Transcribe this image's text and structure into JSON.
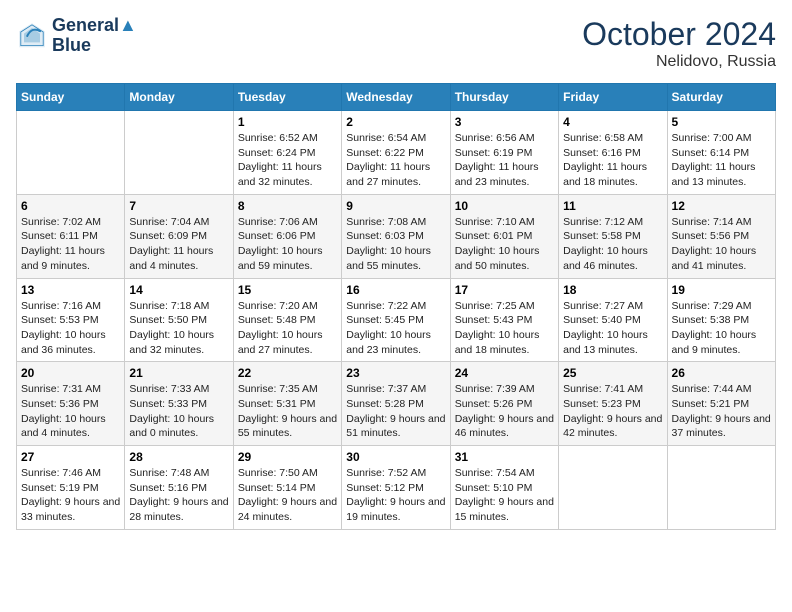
{
  "logo": {
    "line1": "General",
    "line2": "Blue"
  },
  "title": "October 2024",
  "location": "Nelidovo, Russia",
  "weekdays": [
    "Sunday",
    "Monday",
    "Tuesday",
    "Wednesday",
    "Thursday",
    "Friday",
    "Saturday"
  ],
  "weeks": [
    [
      null,
      null,
      {
        "day": 1,
        "sunrise": "6:52 AM",
        "sunset": "6:24 PM",
        "daylight": "11 hours and 32 minutes."
      },
      {
        "day": 2,
        "sunrise": "6:54 AM",
        "sunset": "6:22 PM",
        "daylight": "11 hours and 27 minutes."
      },
      {
        "day": 3,
        "sunrise": "6:56 AM",
        "sunset": "6:19 PM",
        "daylight": "11 hours and 23 minutes."
      },
      {
        "day": 4,
        "sunrise": "6:58 AM",
        "sunset": "6:16 PM",
        "daylight": "11 hours and 18 minutes."
      },
      {
        "day": 5,
        "sunrise": "7:00 AM",
        "sunset": "6:14 PM",
        "daylight": "11 hours and 13 minutes."
      }
    ],
    [
      {
        "day": 6,
        "sunrise": "7:02 AM",
        "sunset": "6:11 PM",
        "daylight": "11 hours and 9 minutes."
      },
      {
        "day": 7,
        "sunrise": "7:04 AM",
        "sunset": "6:09 PM",
        "daylight": "11 hours and 4 minutes."
      },
      {
        "day": 8,
        "sunrise": "7:06 AM",
        "sunset": "6:06 PM",
        "daylight": "10 hours and 59 minutes."
      },
      {
        "day": 9,
        "sunrise": "7:08 AM",
        "sunset": "6:03 PM",
        "daylight": "10 hours and 55 minutes."
      },
      {
        "day": 10,
        "sunrise": "7:10 AM",
        "sunset": "6:01 PM",
        "daylight": "10 hours and 50 minutes."
      },
      {
        "day": 11,
        "sunrise": "7:12 AM",
        "sunset": "5:58 PM",
        "daylight": "10 hours and 46 minutes."
      },
      {
        "day": 12,
        "sunrise": "7:14 AM",
        "sunset": "5:56 PM",
        "daylight": "10 hours and 41 minutes."
      }
    ],
    [
      {
        "day": 13,
        "sunrise": "7:16 AM",
        "sunset": "5:53 PM",
        "daylight": "10 hours and 36 minutes."
      },
      {
        "day": 14,
        "sunrise": "7:18 AM",
        "sunset": "5:50 PM",
        "daylight": "10 hours and 32 minutes."
      },
      {
        "day": 15,
        "sunrise": "7:20 AM",
        "sunset": "5:48 PM",
        "daylight": "10 hours and 27 minutes."
      },
      {
        "day": 16,
        "sunrise": "7:22 AM",
        "sunset": "5:45 PM",
        "daylight": "10 hours and 23 minutes."
      },
      {
        "day": 17,
        "sunrise": "7:25 AM",
        "sunset": "5:43 PM",
        "daylight": "10 hours and 18 minutes."
      },
      {
        "day": 18,
        "sunrise": "7:27 AM",
        "sunset": "5:40 PM",
        "daylight": "10 hours and 13 minutes."
      },
      {
        "day": 19,
        "sunrise": "7:29 AM",
        "sunset": "5:38 PM",
        "daylight": "10 hours and 9 minutes."
      }
    ],
    [
      {
        "day": 20,
        "sunrise": "7:31 AM",
        "sunset": "5:36 PM",
        "daylight": "10 hours and 4 minutes."
      },
      {
        "day": 21,
        "sunrise": "7:33 AM",
        "sunset": "5:33 PM",
        "daylight": "10 hours and 0 minutes."
      },
      {
        "day": 22,
        "sunrise": "7:35 AM",
        "sunset": "5:31 PM",
        "daylight": "9 hours and 55 minutes."
      },
      {
        "day": 23,
        "sunrise": "7:37 AM",
        "sunset": "5:28 PM",
        "daylight": "9 hours and 51 minutes."
      },
      {
        "day": 24,
        "sunrise": "7:39 AM",
        "sunset": "5:26 PM",
        "daylight": "9 hours and 46 minutes."
      },
      {
        "day": 25,
        "sunrise": "7:41 AM",
        "sunset": "5:23 PM",
        "daylight": "9 hours and 42 minutes."
      },
      {
        "day": 26,
        "sunrise": "7:44 AM",
        "sunset": "5:21 PM",
        "daylight": "9 hours and 37 minutes."
      }
    ],
    [
      {
        "day": 27,
        "sunrise": "7:46 AM",
        "sunset": "5:19 PM",
        "daylight": "9 hours and 33 minutes."
      },
      {
        "day": 28,
        "sunrise": "7:48 AM",
        "sunset": "5:16 PM",
        "daylight": "9 hours and 28 minutes."
      },
      {
        "day": 29,
        "sunrise": "7:50 AM",
        "sunset": "5:14 PM",
        "daylight": "9 hours and 24 minutes."
      },
      {
        "day": 30,
        "sunrise": "7:52 AM",
        "sunset": "5:12 PM",
        "daylight": "9 hours and 19 minutes."
      },
      {
        "day": 31,
        "sunrise": "7:54 AM",
        "sunset": "5:10 PM",
        "daylight": "9 hours and 15 minutes."
      },
      null,
      null
    ]
  ]
}
